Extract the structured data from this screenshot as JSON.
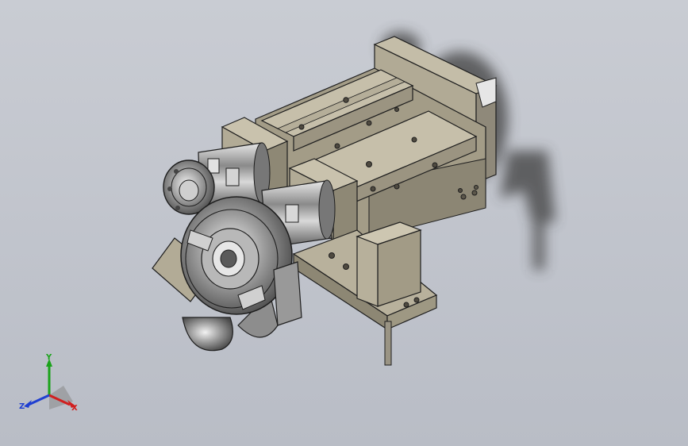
{
  "viewport": {
    "background_top": "#c9ccd3",
    "background_bottom": "#b9bdc6"
  },
  "model": {
    "part_color": "#a8a18c",
    "edge_color": "#1e1e1e",
    "chrome_color": "#cfcfcf"
  },
  "triad": {
    "x_label": "X",
    "y_label": "Y",
    "z_label": "Z",
    "x_color": "#d11f1f",
    "y_color": "#1aa31a",
    "z_color": "#1f3fd1"
  }
}
